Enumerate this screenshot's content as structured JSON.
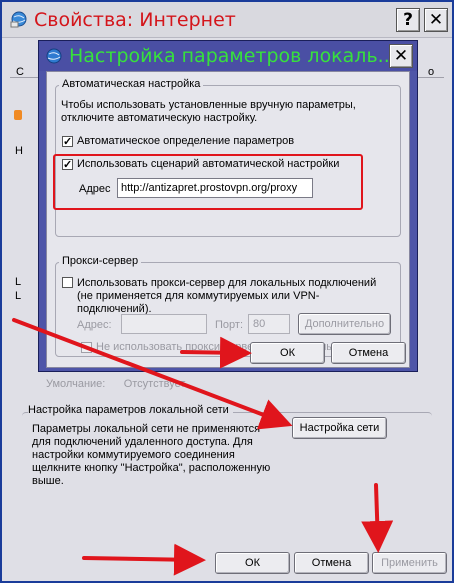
{
  "outer": {
    "title": "Свойства: Интернет",
    "help_label": "?",
    "close_label": "✕",
    "partial_tab_left": "С",
    "partial_tab_right": "о",
    "partial_text_1": "Н",
    "partial_text_2": "L",
    "partial_text_3": "L",
    "default_row": "Умолчание:      Отсутствует",
    "lan_group_title": "Настройка параметров локальной сети",
    "lan_description": "Параметры локальной сети не применяются для подключений удаленного доступа. Для настройки коммутируемого соединения щелкните кнопку \"Настройка\", расположенную выше.",
    "lan_settings_button": "Настройка сети",
    "ok_button": "ОК",
    "cancel_button": "Отмена",
    "apply_button": "Применить"
  },
  "inner": {
    "title": "Настройка параметров локаль...",
    "close_label": "✕",
    "auto_group_title": "Автоматическая настройка",
    "auto_description": "Чтобы использовать установленные вручную параметры, отключите автоматическую настройку.",
    "auto_detect_label": "Автоматическое определение параметров",
    "auto_detect_checked": true,
    "use_script_label": "Использовать сценарий автоматической настройки",
    "use_script_checked": true,
    "address_label": "Адрес",
    "address_value": "http://antizapret.prostovpn.org/proxy",
    "proxy_group_title": "Прокси-сервер",
    "use_proxy_label": "Использовать прокси-сервер для локальных подключений (не применяется для коммутируемых или VPN-подключений).",
    "use_proxy_checked": false,
    "proxy_address_label": "Адрес:",
    "proxy_address_value": "",
    "proxy_port_label": "Порт:",
    "proxy_port_value": "80",
    "advanced_button": "Дополнительно",
    "bypass_label": "Не использовать прокси-сервер для локальных адресов",
    "bypass_checked": false,
    "ok_button": "ОК",
    "cancel_button": "Отмена"
  },
  "colors": {
    "annotation_red": "#e0151c",
    "outer_title_text": "#d4151b",
    "inner_title_text": "#37e13c",
    "inner_title_bar": "#4a4fa4"
  }
}
